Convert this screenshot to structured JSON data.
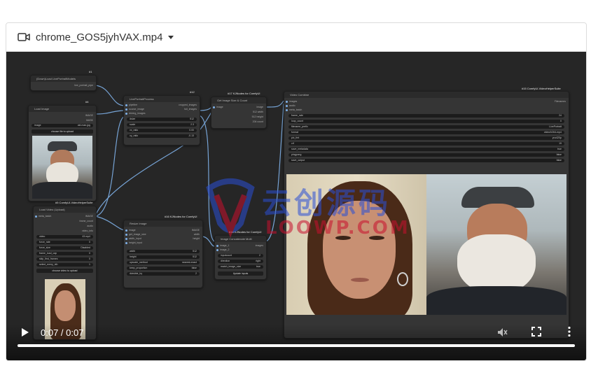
{
  "header": {
    "file_name": "chrome_GOS5jyhVAX.mp4"
  },
  "player": {
    "time_display": "0:07 / 0:07",
    "progress": 1.0
  },
  "watermark": {
    "cn": "云创源码",
    "en": "LOOWP.COM"
  },
  "nodes": {
    "n1": {
      "badge": "#1",
      "title": "(Down)Load LivePortraitModels",
      "port": "live_portrait_pipe"
    },
    "n4": {
      "badge": "#4",
      "title": "Load Image",
      "out1": "IMAGE",
      "out2": "MASK",
      "row": "image",
      "row_val": "old-man.jpg",
      "button": "choose file to upload"
    },
    "n12": {
      "badge": "#12",
      "title": "LivePortraitProcess",
      "in1": "pipeline",
      "in2": "source_image",
      "in3": "driving_images",
      "out1": "cropped_images",
      "out2": "full_images",
      "rows": [
        [
          "dsize",
          "512"
        ],
        [
          "scale",
          "2.3"
        ],
        [
          "vx_ratio",
          "0.00"
        ],
        [
          "vy_ratio",
          "-0.13"
        ]
      ]
    },
    "n17": {
      "badge": "#17 KJNodes for ComfyUI",
      "title": "Get Image Size & Count",
      "in1": "image",
      "out1": "image",
      "out2": "512 width",
      "out3": "512 height",
      "out4": "204 count"
    },
    "n15": {
      "badge": "#15 ComfyUI-VideoHelperSuite",
      "title": "Video Combine",
      "in1": "images",
      "in2": "audio",
      "in3": "meta_batch",
      "right": "Filenames",
      "rows": [
        [
          "frame_rate",
          "24"
        ],
        [
          "loop_count",
          "0"
        ],
        [
          "filename_prefix",
          "LivePortrait"
        ],
        [
          "format",
          "video/h264-mp4"
        ],
        [
          "pix_fmt",
          "yuv420p"
        ],
        [
          "crf",
          "19"
        ],
        [
          "save_metadata",
          "true"
        ],
        [
          "pingpong",
          "false"
        ],
        [
          "save_output",
          "false"
        ]
      ]
    },
    "n5": {
      "badge": "#5 ComfyUI-VideoHelperSuite",
      "title": "Load Video (Upload)",
      "in1": "meta_batch",
      "out1": "IMAGE",
      "out2": "frame_count",
      "out3": "audio",
      "out4": "video_info",
      "rows": [
        [
          "video",
          "43.mp4"
        ],
        [
          "force_rate",
          "0"
        ],
        [
          "force_size",
          "Disabled"
        ],
        [
          "frame_load_cap",
          "0"
        ],
        [
          "skip_first_frames",
          "0"
        ],
        [
          "select_every_nth",
          "1"
        ]
      ],
      "button": "choose video to upload"
    },
    "n16": {
      "badge": "#16 KJNodes for ComfyUI",
      "title": "Resize Image",
      "in1": "image",
      "in2": "get_image_size",
      "in3": "width_input",
      "in4": "height_input",
      "out1": "IMAGE",
      "out2": "width",
      "out3": "height",
      "rows": [
        [
          "width",
          "512"
        ],
        [
          "height",
          "512"
        ],
        [
          "upscale_method",
          "nearest-exact"
        ],
        [
          "keep_proportion",
          "false"
        ],
        [
          "divisible_by",
          "2"
        ]
      ]
    },
    "n18": {
      "badge": "#18 KJNodes for ComfyUI",
      "title": "Image Concatenate Multi",
      "in1": "image_1",
      "in2": "image_2",
      "out1": "images",
      "rows": [
        [
          "inputcount",
          "2"
        ],
        [
          "direction",
          "right"
        ],
        [
          "match_image_size",
          "true"
        ]
      ],
      "button": "Update inputs"
    }
  },
  "icons": {
    "file": "video-camera-icon",
    "play": "play-icon",
    "mute": "volume-muted-icon",
    "fullscreen": "fullscreen-icon",
    "more": "more-vertical-icon"
  }
}
